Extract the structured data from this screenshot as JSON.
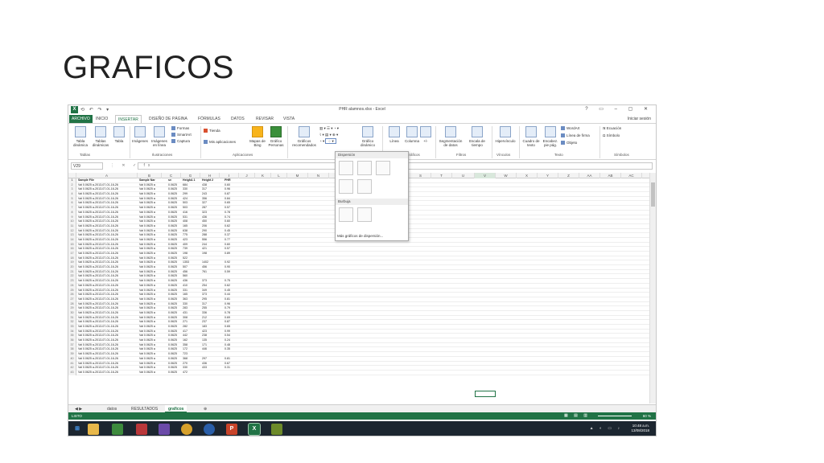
{
  "slide": {
    "title": "GRAFICOS"
  },
  "excel": {
    "doc_title": "PHR alamnos.xlsx - Excel",
    "qat": "⟲ ↶ ↷ ▾",
    "window_buttons": "? ▭ – ▢ ✕",
    "tabs": [
      "ARCHIVO",
      "INICIO",
      "INSERTAR",
      "DISEÑO DE PÁGINA",
      "FÓRMULAS",
      "DATOS",
      "REVISAR",
      "VISTA"
    ],
    "active_tab": "INSERTAR",
    "signin": "Iniciar sesión",
    "ribbon": {
      "tabla_dinamica": "Tabla dinámica",
      "tablas_dinamicas_recomendadas": "Tablas dinámicas",
      "tabla": "Tabla",
      "imagenes": "Imágenes",
      "imagenes_en_linea": "Imágenes en línea",
      "formas": "Formas",
      "smartart": "SmartArt",
      "captura": "Captura",
      "tienda": "Tienda",
      "mis_aplicaciones": "Mis aplicaciones",
      "mapas_bing": "Mapas de Bing",
      "grafico_personas": "Gráfico Personas",
      "graficos_recomendados": "Gráficos recomendados",
      "grafico_dinamico": "Gráfico dinámico",
      "linea": "Línea",
      "columna": "Columna",
      "ganancias": "+/-",
      "segmentacion": "Segmentación de datos",
      "escala_tiempo": "Escala de tiempo",
      "hipervinculo": "Hipervínculo",
      "cuadro_texto": "Cuadro de texto",
      "encabezado": "Encabez. pie pág.",
      "wordart": "WordArt",
      "linea_firma": "Línea de firma",
      "objeto": "Objeto",
      "ecuacion": "Ecuación",
      "simbolo": "Símbolo",
      "groups": {
        "tablas": "Tablas",
        "ilustraciones": "Ilustraciones",
        "aplicaciones": "Aplicaciones",
        "graficos": "Gráficos",
        "filtros": "Filtros",
        "vinculos": "Vínculos",
        "texto": "Texto",
        "simbolos": "Símbolos"
      }
    },
    "name_box": "V29",
    "formula_icons": "⋮ ✕ ✓ fx",
    "columns": [
      "A",
      "B",
      "C",
      "G",
      "H",
      "I",
      "J",
      "K",
      "L",
      "M",
      "N",
      "S",
      "T",
      "U",
      "V",
      "W",
      "X",
      "Y",
      "Z",
      "AA",
      "AB",
      "AC"
    ],
    "header_row": [
      "Sample File",
      "Sample Nar",
      "sv",
      "HeighA 1",
      "Height 2",
      "PHR"
    ],
    "rows": [
      [
        "Val 0.0625 a-2013-07-01-16-26",
        "Val 0.0625 a",
        "0.0625",
        "684",
        "438",
        "0.60"
      ],
      [
        "Val 0.0625 a-2013-07-01-16-26",
        "Val 0.0625 a",
        "0.0625",
        "330",
        "317",
        "0.96"
      ],
      [
        "Val 0.0625 a-2013-07-01-16-26",
        "Val 0.0625 a",
        "0.0625",
        "299",
        "243",
        "0.87"
      ],
      [
        "Val 0.0625 a-2013-07-01-16-26",
        "Val 0.0625 a",
        "0.0625",
        "424",
        "356",
        "0.84"
      ],
      [
        "Val 0.0625 a-2013-07-01-16-26",
        "Val 0.0625 a",
        "0.0625",
        "503",
        "327",
        "0.65"
      ],
      [
        "Val 0.0625 a-2013-07-01-16-26",
        "Val 0.0625 a",
        "0.0625",
        "503",
        "287",
        "0.57"
      ],
      [
        "Val 0.0625 a-2013-07-01-16-26",
        "Val 0.0625 a",
        "0.0625",
        "416",
        "323",
        "0.78"
      ],
      [
        "Val 0.0625 a-2013-07-01-16-26",
        "Val 0.0625 a",
        "0.0625",
        "531",
        "436",
        "0.74"
      ],
      [
        "Val 0.0625 a-2013-07-01-16-26",
        "Val 0.0625 a",
        "0.0625",
        "408",
        "450",
        "0.60"
      ],
      [
        "Val 0.0625 a-2013-07-01-16-26",
        "Val 0.0625 a",
        "0.0625",
        "165",
        "206",
        "0.62"
      ],
      [
        "Val 0.0625 a-2013-07-01-16-26",
        "Val 0.0625 a",
        "0.0625",
        "638",
        "290",
        "0.45"
      ],
      [
        "Val 0.0625 a-2013-07-01-16-26",
        "Val 0.0625 a",
        "0.0625",
        "775",
        "288",
        "0.37"
      ],
      [
        "Val 0.0625 a-2013-07-01-16-26",
        "Val 0.0625 a",
        "0.0625",
        "423",
        "556",
        "0.77"
      ],
      [
        "Val 0.0625 a-2013-07-01-16-26",
        "Val 0.0625 a",
        "0.0625",
        "409",
        "244",
        "0.60"
      ],
      [
        "Val 0.0625 a-2013-07-01-16-26",
        "Val 0.0625 a",
        "0.0625",
        "739",
        "421",
        "0.57"
      ],
      [
        "Val 0.0625 a-2013-07-01-16-26",
        "Val 0.0625 a",
        "0.0625",
        "198",
        "198",
        "0.89"
      ],
      [
        "Val 0.0625 a-2013-07-01-16-26",
        "Val 0.0625 a",
        "0.0625",
        "522",
        "",
        ""
      ],
      [
        "Val 0.0625 a-2013-07-01-16-26",
        "Val 0.0625 a",
        "0.0625",
        "1353",
        "1402",
        "0.92"
      ],
      [
        "Val 0.0625 a-2013-07-01-16-26",
        "Val 0.0625 a",
        "0.0625",
        "507",
        "456",
        "0.90"
      ],
      [
        "Val 0.0625 a-2013-07-01-16-26",
        "Val 0.0625 a",
        "0.0625",
        "456",
        "761",
        "0.59"
      ],
      [
        "Val 0.0625 a-2013-07-01-16-26",
        "Val 0.0625 a",
        "0.0625",
        "560",
        "",
        ""
      ],
      [
        "Val 0.0625 a-2013-07-01-16-26",
        "Val 0.0625 a",
        "0.0625",
        "436",
        "373",
        "0.75"
      ],
      [
        "Val 0.0625 a-2013-07-01-16-26",
        "Val 0.0625 a",
        "0.0625",
        "410",
        "254",
        "0.62"
      ],
      [
        "Val 0.0625 a-2013-07-01-16-26",
        "Val 0.0625 a",
        "0.0625",
        "331",
        "349",
        "0.45"
      ],
      [
        "Val 0.0625 a-2013-07-01-16-26",
        "Val 0.0625 a",
        "0.0625",
        "165",
        "373",
        "0.44"
      ],
      [
        "Val 0.0625 a-2013-07-01-16-26",
        "Val 0.0625 a",
        "0.0625",
        "363",
        "295",
        "0.81"
      ],
      [
        "Val 0.0625 a-2013-07-01-16-26",
        "Val 0.0625 a",
        "0.0625",
        "330",
        "317",
        "0.96"
      ],
      [
        "Val 0.0625 a-2013-07-01-16-26",
        "Val 0.0625 a",
        "0.0625",
        "283",
        "255",
        "0.79"
      ],
      [
        "Val 0.0625 a-2013-07-01-16-26",
        "Val 0.0625 a",
        "0.0625",
        "431",
        "336",
        "0.78"
      ],
      [
        "Val 0.0625 a-2013-07-01-16-26",
        "Val 0.0625 a",
        "0.0625",
        "308",
        "212",
        "0.69"
      ],
      [
        "Val 0.0625 a-2013-07-01-16-26",
        "Val 0.0625 a",
        "0.0625",
        "271",
        "237",
        "0.87"
      ],
      [
        "Val 0.0625 a-2013-07-01-16-26",
        "Val 0.0625 a",
        "0.0625",
        "282",
        "183",
        "0.65"
      ],
      [
        "Val 0.0625 a-2013-07-01-16-26",
        "Val 0.0625 a",
        "0.0625",
        "417",
        "423",
        "0.99"
      ],
      [
        "Val 0.0625 a-2013-07-01-16-26",
        "Val 0.0625 a",
        "0.0625",
        "442",
        "238",
        "0.54"
      ],
      [
        "Val 0.0625 a-2013-07-01-16-26",
        "Val 0.0625 a",
        "0.0625",
        "162",
        "135",
        "0.24"
      ],
      [
        "Val 0.0625 a-2013-07-01-16-26",
        "Val 0.0625 a",
        "0.0625",
        "358",
        "171",
        "0.48"
      ],
      [
        "Val 0.0625 a-2013-07-01-16-26",
        "Val 0.0625 a",
        "0.0625",
        "172",
        "446",
        "0.35"
      ],
      [
        "Val 0.0625 a-2013-07-01-16-26",
        "Val 0.0625 a",
        "0.0625",
        "723",
        "",
        ""
      ],
      [
        "Val 0.0625 a-2013-07-01-16-26",
        "Val 0.0625 a",
        "0.0625",
        "368",
        "297",
        "0.81"
      ],
      [
        "Val 0.0625 a-2013-07-01-16-26",
        "Val 0.0625 a",
        "0.0625",
        "270",
        "436",
        "0.67"
      ],
      [
        "Val 0.0625 a-2013-07-01-16-26",
        "Val 0.0625 a",
        "0.0625",
        "330",
        "433",
        "0.31"
      ],
      [
        "Val 0.0625 a-2013-07-01-16-26",
        "Val 0.0625 a",
        "0.0625",
        "472",
        "",
        ""
      ]
    ],
    "dropdown": {
      "section_scatter": "Dispersión",
      "section_bubble": "Burbuja",
      "more": "Más gráficos de dispersión..."
    },
    "sheet_tabs": [
      "datos",
      "RESULTADOS",
      "graficos"
    ],
    "active_sheet": "graficos",
    "status": {
      "ready": "LISTO",
      "zoom": "60 %",
      "view_icons": "▦ ▤ ▥"
    },
    "taskbar": {
      "time": "10:48 a.m.",
      "date": "13/08/2018",
      "tray": "▲ ◐ ▭ ♪"
    }
  }
}
